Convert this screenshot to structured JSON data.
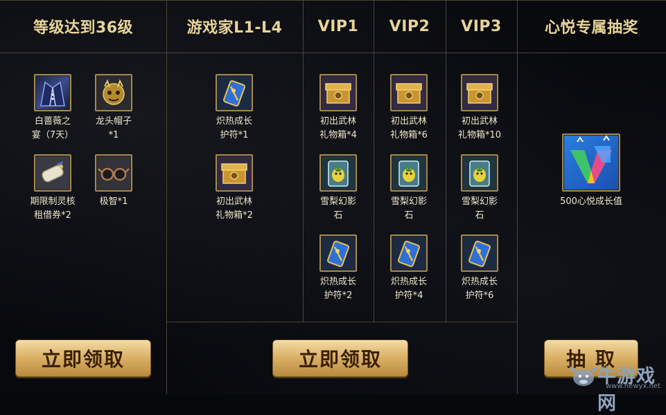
{
  "headers": {
    "level": "等级达到36级",
    "gamer": "游戏家L1-L4",
    "vip1": "VIP1",
    "vip2": "VIP2",
    "vip3": "VIP3",
    "xinyue": "心悦专属抽奖"
  },
  "level_items": [
    {
      "label_1": "白蔷薇之",
      "label_2": "宴（7天）",
      "icon": "white-suit-icon"
    },
    {
      "label_1": "龙头帽子",
      "label_2": "*1",
      "icon": "dragon-hat-icon"
    },
    {
      "label_1": "期限制灵核",
      "label_2": "租借券*2",
      "icon": "scroll-voucher-icon"
    },
    {
      "label_1": "极智*1",
      "label_2": "",
      "icon": "glasses-icon"
    }
  ],
  "gamer_items": [
    {
      "label_1": "炽热成长",
      "label_2": "护符*1",
      "icon": "amulet-icon"
    },
    {
      "label_1": "初出武林",
      "label_2": "礼物箱*2",
      "icon": "gift-box-icon"
    }
  ],
  "vip1_items": [
    {
      "label_1": "初出武林",
      "label_2": "礼物箱*4",
      "icon": "gift-box-icon"
    },
    {
      "label_1": "雪梨幻影",
      "label_2": "石",
      "icon": "phantom-stone-icon"
    },
    {
      "label_1": "炽热成长",
      "label_2": "护符*2",
      "icon": "amulet-icon"
    }
  ],
  "vip2_items": [
    {
      "label_1": "初出武林",
      "label_2": "礼物箱*6",
      "icon": "gift-box-icon"
    },
    {
      "label_1": "雪梨幻影",
      "label_2": "石",
      "icon": "phantom-stone-icon"
    },
    {
      "label_1": "炽热成长",
      "label_2": "护符*4",
      "icon": "amulet-icon"
    }
  ],
  "vip3_items": [
    {
      "label_1": "初出武林",
      "label_2": "礼物箱*10",
      "icon": "gift-box-icon"
    },
    {
      "label_1": "雪梨幻影",
      "label_2": "石",
      "icon": "phantom-stone-icon"
    },
    {
      "label_1": "炽热成长",
      "label_2": "护符*6",
      "icon": "amulet-icon"
    }
  ],
  "xinyue_item": {
    "label_1": "500心悦成长值",
    "icon": "xinyue-growth-icon"
  },
  "buttons": {
    "claim_left": "立即领取",
    "claim_middle": "立即领取",
    "draw": "抽 取"
  },
  "watermark": {
    "name": "牛游戏网",
    "url": "www.newyx.net",
    "icon": "cow-logo-icon"
  },
  "colors": {
    "header_text": "#e8d49a",
    "border": "#4a4436",
    "button_gold": "#dcb36a",
    "item_text": "#f0e6cc"
  }
}
